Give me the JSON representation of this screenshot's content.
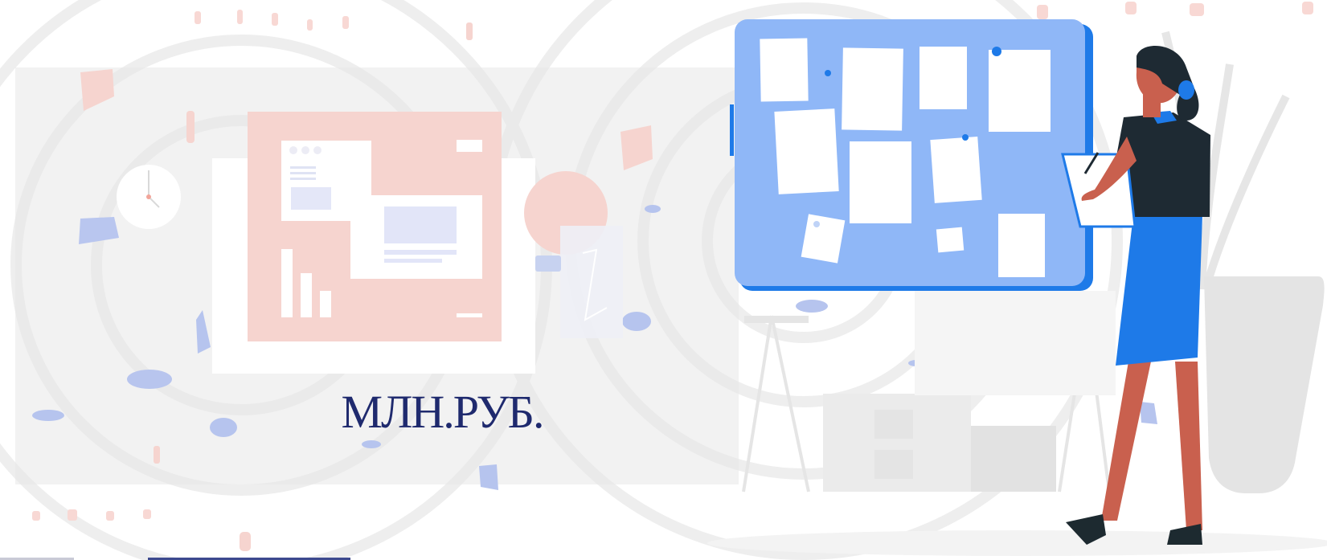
{
  "caption": "МЛН.РУБ.",
  "colors": {
    "navy_text": "#1f2a6e",
    "board_blue": "#8fb7f7",
    "skirt_blue": "#1e7ae8",
    "pink": "#f6d4cf",
    "skin": "#c9604e"
  },
  "icons": [
    "clock-icon",
    "presentation-illustration",
    "kanban-board-illustration",
    "woman-with-clipboard-illustration",
    "plant-pot-illustration"
  ]
}
